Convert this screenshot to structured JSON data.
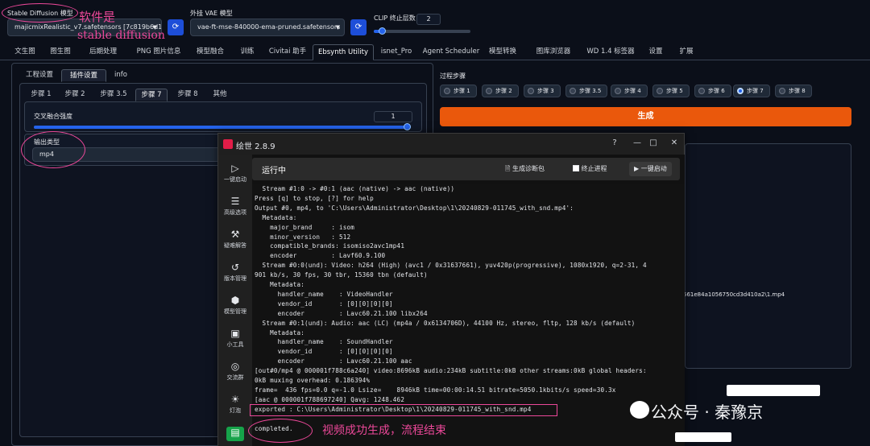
{
  "top": {
    "sd_model_label": "Stable Diffusion 模型",
    "sd_model_value": "majicmixRealistic_v7.safetensors [7c819b6d13]",
    "vae_label": "外挂 VAE 模型",
    "vae_value": "vae-ft-mse-840000-ema-pruned.safetensors",
    "clip_label": "CLIP 终止层数",
    "clip_value": "2",
    "clip_fraction": 0.08
  },
  "annotations": {
    "software_is": "软件是",
    "stable_diffusion": "stable diffusion",
    "video_done": "视频成功生成，流程结束"
  },
  "tabs": [
    "文生图",
    "图生图",
    "后期处理",
    "PNG 图片信息",
    "模型融合",
    "训练",
    "Civitai 助手",
    "Ebsynth Utility",
    "isnet_Pro",
    "Agent Scheduler",
    "模型转换",
    "图库浏览器",
    "WD 1.4 标签器",
    "设置",
    "扩展"
  ],
  "active_tab": "Ebsynth Utility",
  "left": {
    "subtabs": [
      "工程设置",
      "插件设置",
      "info"
    ],
    "active_subtab": "插件设置",
    "steps": [
      "步骤 1",
      "步骤 2",
      "步骤 3.5",
      "步骤 7",
      "步骤 8",
      "其他"
    ],
    "active_step": "步骤 7",
    "crossfade_label": "交叉融合强度",
    "crossfade_value": "1",
    "crossfade_fraction": 1.0,
    "output_type_label": "输出类型",
    "output_type_value": "mp4"
  },
  "right": {
    "process_label": "过程步骤",
    "steps": [
      "步骤 1",
      "步骤 2",
      "步骤 3",
      "步骤 3.5",
      "步骤 4",
      "步骤 5",
      "步骤 6",
      "步骤 7",
      "步骤 8"
    ],
    "checked_step": "步骤 7",
    "generate_label": "生成",
    "path_fragment": "561e84a1056750cd3d410a2\\1.mp4"
  },
  "app": {
    "title": "绘世 2.8.9",
    "window_controls": [
      "?",
      "—",
      "□",
      "✕"
    ],
    "sidebar": [
      {
        "icon": "▷",
        "label": "一键启动"
      },
      {
        "icon": "☰",
        "label": "高级选项"
      },
      {
        "icon": "⚒",
        "label": "疑难解答"
      },
      {
        "icon": "↺",
        "label": "版本管理"
      },
      {
        "icon": "⬢",
        "label": "模型管理"
      },
      {
        "icon": "▣",
        "label": "小工具"
      },
      {
        "icon": "◎",
        "label": "交流群"
      },
      {
        "icon": "☀",
        "label": "灯泡"
      },
      {
        "icon": "▤",
        "label": ""
      }
    ],
    "run_title": "运行中",
    "actions": {
      "diag_icon": "🗎",
      "diag": "生成诊断包",
      "stop": "终止进程",
      "launch_icon": "▶",
      "launch": "一键启动"
    },
    "console": [
      "  Stream #1:0 -> #0:1 (aac (native) -> aac (native))",
      "Press [q] to stop, [?] for help",
      "Output #0, mp4, to 'C:\\Users\\Administrator\\Desktop\\1\\20240829-011745_with_snd.mp4':",
      "  Metadata:",
      "    major_brand     : isom",
      "    minor_version   : 512",
      "    compatible_brands: isomiso2avc1mp41",
      "    encoder         : Lavf60.9.100",
      "  Stream #0:0(und): Video: h264 (High) (avc1 / 0x31637661), yuv420p(progressive), 1080x1920, q=2-31, 4",
      "901 kb/s, 30 fps, 30 tbr, 15360 tbn (default)",
      "    Metadata:",
      "      handler_name    : VideoHandler",
      "      vendor_id       : [0][0][0][0]",
      "      encoder         : Lavc60.21.100 libx264",
      "  Stream #0:1(und): Audio: aac (LC) (mp4a / 0x6134706D), 44100 Hz, stereo, fltp, 128 kb/s (default)",
      "    Metadata:",
      "      handler_name    : SoundHandler",
      "      vendor_id       : [0][0][0][0]",
      "      encoder         : Lavc60.21.100 aac",
      "[out#0/mp4 @ 000001f788c6a240] video:8696kB audio:234kB subtitle:0kB other streams:0kB global headers:",
      "0kB muxing overhead: 0.186394%",
      "frame=  436 fps=0.0 q=-1.0 Lsize=    8946kB time=00:00:14.51 bitrate=5050.1kbits/s speed=30.3x",
      "[aac @ 000001f788697240] Qavg: 1248.462",
      "exported : C:\\Users\\Administrator\\Desktop\\1\\20240829-011745_with_snd.mp4",
      "",
      "completed."
    ]
  },
  "watermark": "公众号 · 秦豫京"
}
